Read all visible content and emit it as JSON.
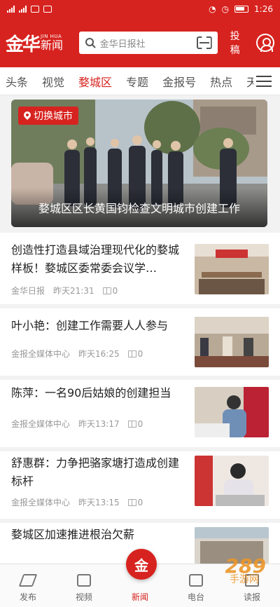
{
  "status": {
    "time": "1:26"
  },
  "header": {
    "logo_main": "金华",
    "logo_en": "JIN HUA",
    "logo_cn": "新闻",
    "search_placeholder": "金华日报社",
    "publish_label": "投稿"
  },
  "tabs": [
    "头条",
    "视觉",
    "婺城区",
    "专题",
    "金报号",
    "热点",
    "天"
  ],
  "active_tab": "婺城区",
  "hero": {
    "city_label": "切换城市",
    "caption": "婺城区区长黄国钧检查文明城市创建工作"
  },
  "articles": [
    {
      "title": "创造性打造县域治理现代化的婺城样板！婺城区委常委会议学…",
      "source": "金华日报",
      "time": "昨天21:31",
      "comments": "0"
    },
    {
      "title": "叶小艳：创建工作需要人人参与",
      "source": "金报全媒体中心",
      "time": "昨天16:25",
      "comments": "0"
    },
    {
      "title": "陈萍：一名90后姑娘的创建担当",
      "source": "金报全媒体中心",
      "time": "昨天13:17",
      "comments": "0"
    },
    {
      "title": "舒惠群：力争把骆家塘打造成创建标杆",
      "source": "金报全媒体中心",
      "time": "昨天13:15",
      "comments": "0"
    },
    {
      "title": "婺城区加速推进根治欠薪",
      "source": "",
      "time": "",
      "comments": ""
    }
  ],
  "bottom_nav": [
    "发布",
    "视频",
    "新闻",
    "电台",
    "读报"
  ],
  "center_logo": "金",
  "watermark": "289",
  "watermark_sub": "手游网",
  "colors": {
    "brand_red": "#d7231f"
  }
}
